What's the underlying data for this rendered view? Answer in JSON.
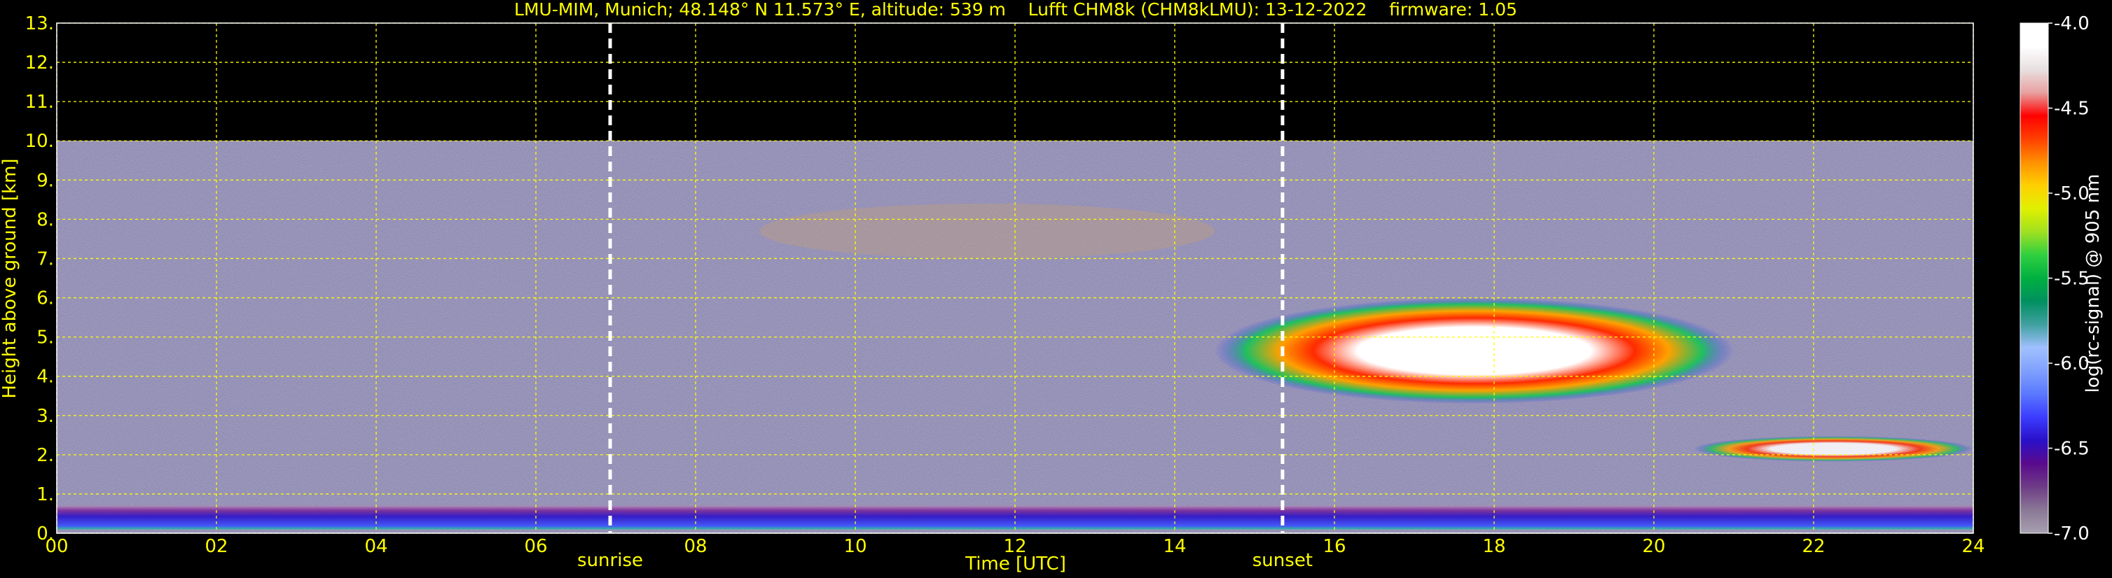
{
  "chart_data": {
    "type": "heatmap",
    "title": "LMU-MIM, Munich; 48.148° N 11.573° E, altitude: 539 m    Lufft CHM8k (CHM8kLMU): 13-12-2022    firmware: 1.05",
    "xlabel": "Time [UTC]",
    "ylabel": "Height above ground [km]",
    "xlim": [
      0,
      24
    ],
    "ylim": [
      0,
      13
    ],
    "x_ticks": [
      "00",
      "02",
      "04",
      "06",
      "08",
      "10",
      "12",
      "14",
      "16",
      "18",
      "20",
      "22",
      "24"
    ],
    "y_ticks": [
      "0.",
      "1.",
      "2.",
      "3.",
      "4.",
      "5.",
      "6.",
      "7.",
      "8.",
      "9.",
      "10.",
      "11.",
      "12.",
      "13."
    ],
    "grid": true,
    "data_max_height_km": 10,
    "markers": [
      {
        "label": "sunrise",
        "x": 6.93
      },
      {
        "label": "sunset",
        "x": 15.35
      }
    ],
    "colorbar": {
      "label": "log(rc-signal) @ 905 nm",
      "range": [
        -7.0,
        -4.0
      ],
      "ticks": [
        "-4.0",
        "-4.5",
        "-5.0",
        "-5.5",
        "-6.0",
        "-6.5",
        "-7.0"
      ],
      "colors": [
        "#a8a0b0",
        "#8a7896",
        "#6e3c86",
        "#5a0a8c",
        "#2a10c8",
        "#3c3cff",
        "#5a78ff",
        "#80a0ff",
        "#a0c0ff",
        "#40a0a0",
        "#009060",
        "#00b040",
        "#30d040",
        "#a0e020",
        "#e0f000",
        "#ffd000",
        "#ff9000",
        "#ff4000",
        "#ff0000",
        "#e8a0a0",
        "#e8e0e0",
        "#ffffff",
        "#ffffff"
      ]
    },
    "features": [
      {
        "name": "boundary layer",
        "x": [
          0,
          24
        ],
        "y": [
          0.1,
          0.7
        ]
      },
      {
        "name": "upper cloud",
        "x": [
          8.8,
          14.5
        ],
        "y": [
          7.0,
          8.4
        ]
      },
      {
        "name": "dense cloud",
        "x": [
          14.5,
          21.0
        ],
        "y": [
          3.3,
          6.0
        ]
      },
      {
        "name": "low cloud layer",
        "x": [
          20.5,
          24
        ],
        "y": [
          1.5,
          2.8
        ]
      }
    ]
  }
}
